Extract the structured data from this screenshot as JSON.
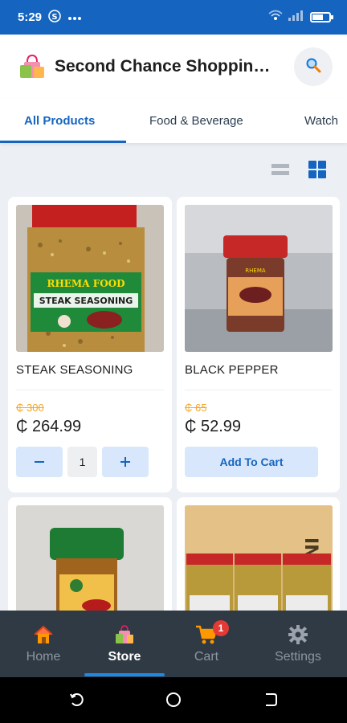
{
  "status_bar": {
    "time": "5:29",
    "notification_icons": [
      "s-icon",
      "more-icon"
    ]
  },
  "header": {
    "title": "Second Chance Shoppin…",
    "logo_icon": "shopping-bag-icon",
    "search_icon": "search-icon"
  },
  "tabs": [
    {
      "label": "All Products",
      "active": true
    },
    {
      "label": "Food & Beverage",
      "active": false
    },
    {
      "label": "Watch",
      "active": false
    }
  ],
  "view_toggles": {
    "list_icon": "list-view-icon",
    "grid_icon": "grid-view-icon",
    "active": "grid"
  },
  "products": [
    {
      "name": "STEAK SEASONING",
      "old_price": "₵ 300",
      "price": "₵ 264.99",
      "quantity": "1",
      "in_cart": true,
      "image_label": "RHEMA FOOD",
      "image_sublabel": "STEAK SEASONING"
    },
    {
      "name": "BLACK PEPPER",
      "old_price": "₵ 65",
      "price": "₵ 52.99",
      "add_to_cart_label": "Add To Cart",
      "in_cart": false
    },
    {
      "name": "",
      "partial": true
    },
    {
      "name": "",
      "partial": true
    }
  ],
  "bottom_nav": [
    {
      "label": "Home",
      "icon": "home-icon",
      "active": false
    },
    {
      "label": "Store",
      "icon": "store-bag-icon",
      "active": true
    },
    {
      "label": "Cart",
      "icon": "cart-icon",
      "active": false,
      "badge": "1"
    },
    {
      "label": "Settings",
      "icon": "gear-icon",
      "active": false
    }
  ],
  "colors": {
    "primary": "#1565c0",
    "accent_orange": "#f5a623",
    "nav_bg": "#2f3a45",
    "badge": "#e53935"
  }
}
